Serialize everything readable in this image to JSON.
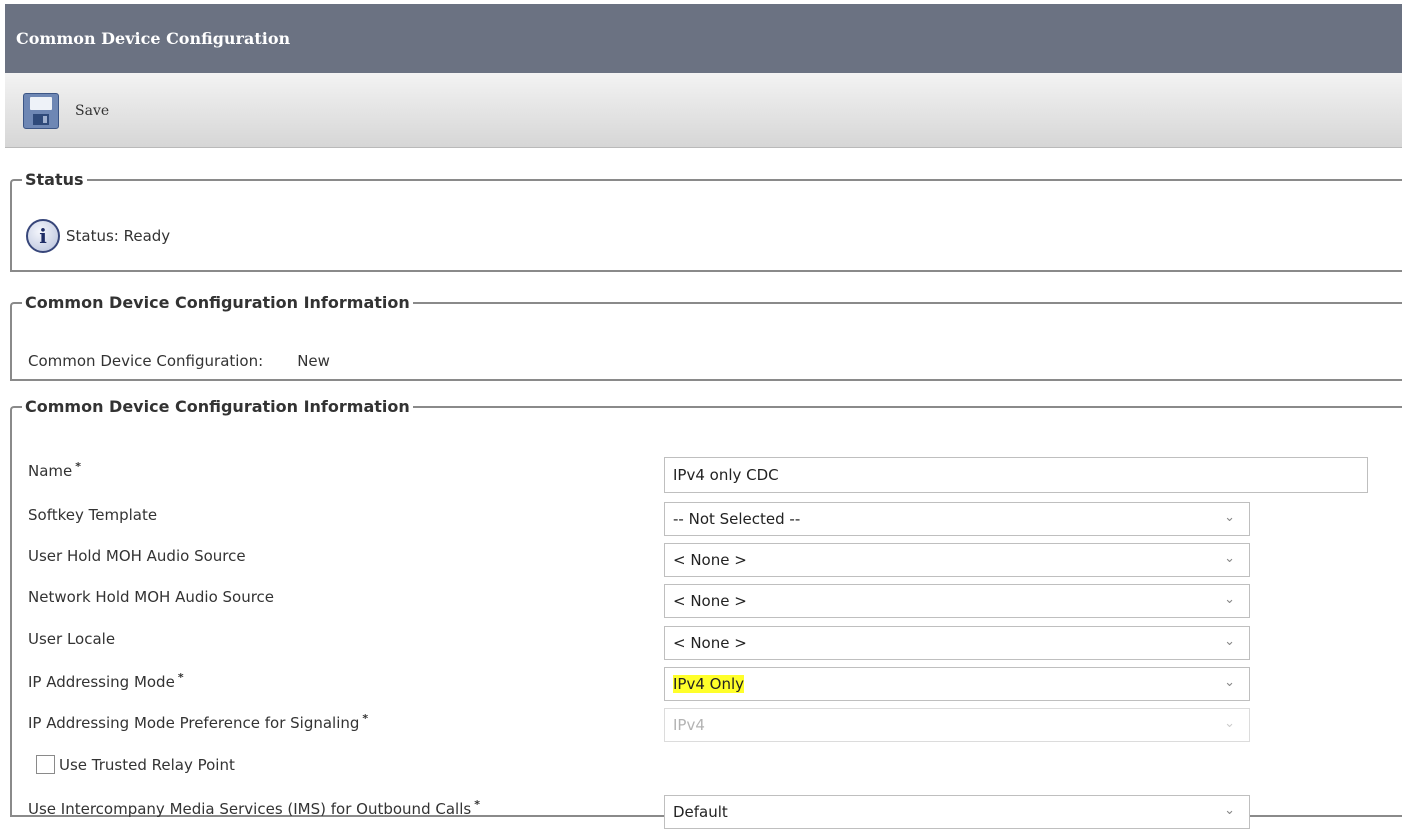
{
  "header": {
    "title": "Common Device Configuration"
  },
  "toolbar": {
    "save_label": "Save",
    "save_icon": "floppy-disk-icon"
  },
  "status_section": {
    "legend": "Status",
    "icon": "info-icon",
    "icon_glyph": "i",
    "text": "Status: Ready"
  },
  "info_section": {
    "legend": "Common Device Configuration Information",
    "label": "Common Device Configuration:",
    "value": "New"
  },
  "config_section": {
    "legend": "Common Device Configuration Information",
    "required_marker": "*",
    "name": {
      "label": "Name",
      "value": "IPv4 only CDC"
    },
    "softkey_template": {
      "label": "Softkey Template",
      "value": "-- Not Selected --"
    },
    "user_hold_moh": {
      "label": "User Hold MOH Audio Source",
      "value": "< None >"
    },
    "network_hold_moh": {
      "label": "Network Hold MOH Audio Source",
      "value": "< None >"
    },
    "user_locale": {
      "label": "User Locale",
      "value": "< None >"
    },
    "ip_addressing_mode": {
      "label": "IP Addressing Mode",
      "value": "IPv4 Only",
      "highlight_color": "#ffff2a"
    },
    "ip_mode_preference": {
      "label": "IP Addressing Mode Preference for Signaling",
      "value": "IPv4",
      "disabled": true
    },
    "trusted_relay": {
      "label": "Use Trusted Relay Point",
      "checked": false
    },
    "ims_outbound": {
      "label": "Use Intercompany Media Services (IMS) for Outbound Calls",
      "value": "Default"
    }
  },
  "colors": {
    "title_bar": "#6b7282",
    "border": "#8a8a8a"
  }
}
